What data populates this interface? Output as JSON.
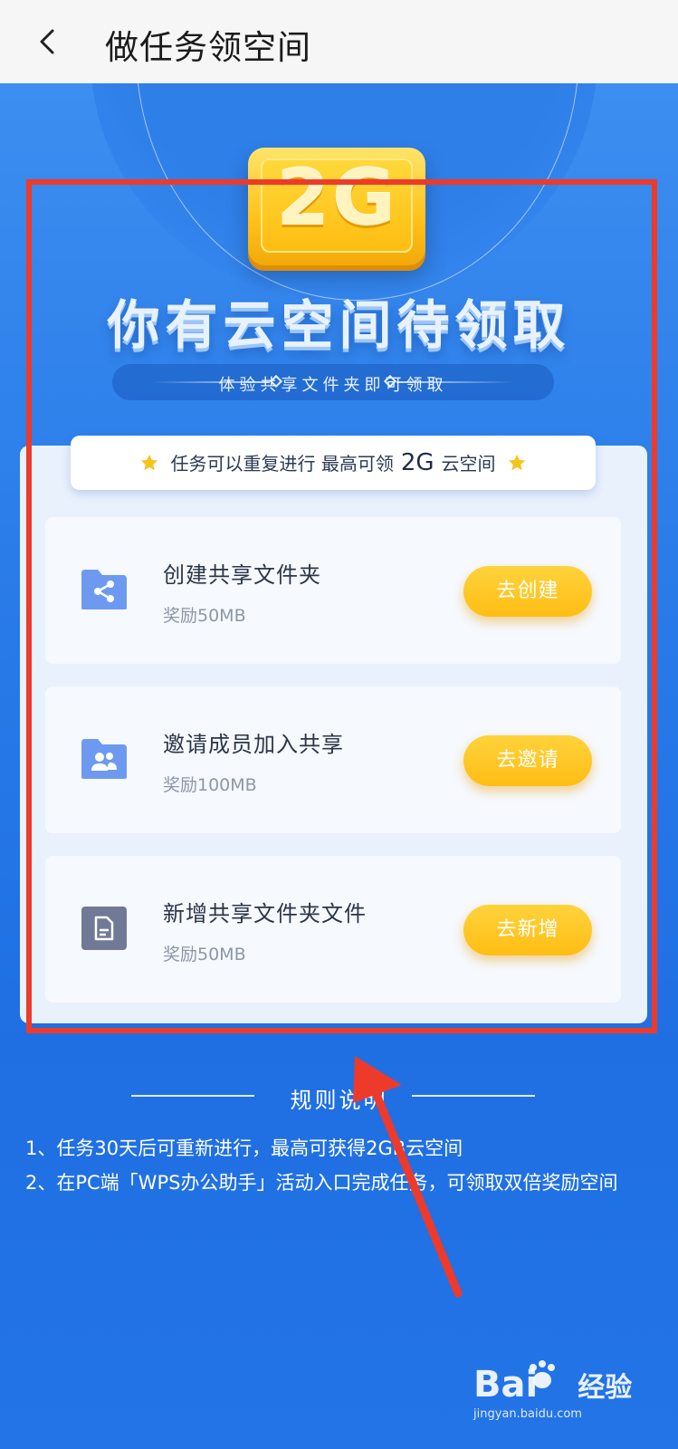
{
  "header": {
    "title": "做任务领空间",
    "back_icon": "chevron-left-icon"
  },
  "hero": {
    "badge_text": "2G",
    "headline": "你有云空间待领取",
    "subtitle": "体验共享文件夹即可领取"
  },
  "tagline": {
    "prefix": "任务可以重复进行 最高可领",
    "highlight": "2G",
    "suffix": "云空间",
    "star_icon": "star-icon",
    "star_color": "#f7c21a"
  },
  "tasks": [
    {
      "title": "创建共享文件夹",
      "reward": "奖励50MB",
      "button": "去创建",
      "icon": "share-folder-icon"
    },
    {
      "title": "邀请成员加入共享",
      "reward": "奖励100MB",
      "button": "去邀请",
      "icon": "members-folder-icon"
    },
    {
      "title": "新增共享文件夹文件",
      "reward": "奖励50MB",
      "button": "去新增",
      "icon": "document-icon"
    }
  ],
  "rules": {
    "title": "规则说明",
    "items": [
      "1、任务30天后可重新进行，最高可获得2GB云空间",
      "2、在PC端「WPS办公助手」活动入口完成任务，可领取双倍奖励空间"
    ]
  },
  "watermark": {
    "logo": "Bai",
    "logo_suffix": "经验",
    "url": "jingyan.baidu.com"
  },
  "colors": {
    "accent_blue": "#2a7ae8",
    "button_yellow": "#ffc21a",
    "annotation_red": "#ee3a2a"
  }
}
